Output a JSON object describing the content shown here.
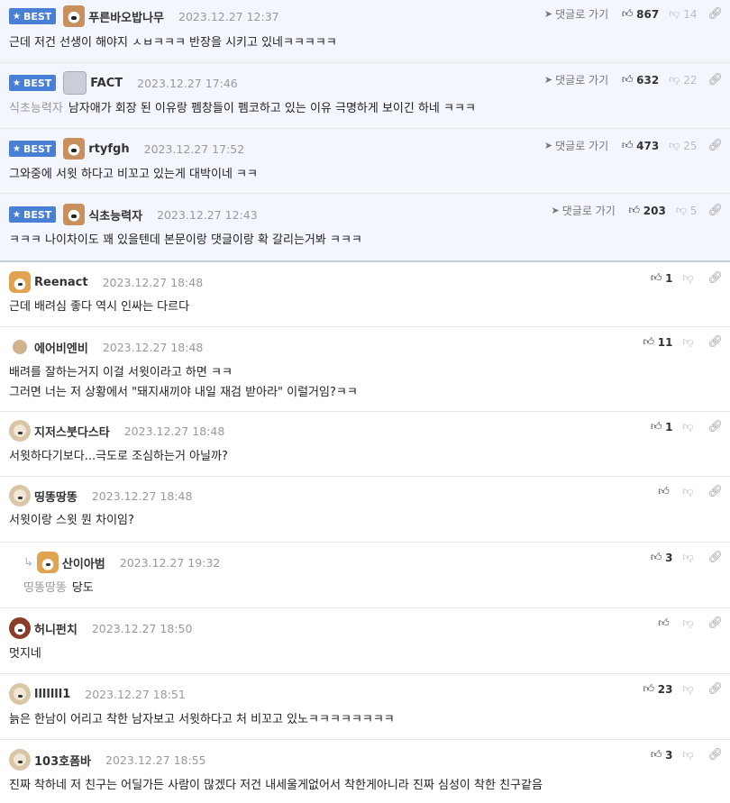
{
  "best_badge": "BEST",
  "go_label": "댓글로 가기",
  "best_comments": [
    {
      "nick": "푸른바오밥나무",
      "time": "2023.12.27 12:37",
      "ref": "",
      "text": "근데 저건 선생이 해야지 ㅅㅂㅋㅋㅋ 반장을 시키고 있네ㅋㅋㅋㅋㅋ",
      "up": "867",
      "down": "14",
      "avatar": "dog-icon"
    },
    {
      "nick": "FACT",
      "time": "2023.12.27 17:46",
      "ref": "식초능력자",
      "text": "남자애가 회장 된 이유랑 펨창들이 펨코하고 있는 이유 극명하게 보이긴 하네 ㅋㅋㅋ",
      "up": "632",
      "down": "22",
      "avatar": "gray-avatar-icon"
    },
    {
      "nick": "rtyfgh",
      "time": "2023.12.27 17:52",
      "ref": "",
      "text": "그와중에 서윗 하다고 비꼬고 있는게 대박이네 ㅋㅋ",
      "up": "473",
      "down": "25",
      "avatar": "dog-icon"
    },
    {
      "nick": "식초능력자",
      "time": "2023.12.27 12:43",
      "ref": "",
      "text": "ㅋㅋㅋ 나이차이도 꽤 있을텐데 본문이랑 댓글이랑 확 갈리는거봐 ㅋㅋㅋ",
      "up": "203",
      "down": "5",
      "avatar": "dog-icon"
    }
  ],
  "comments": [
    {
      "nick": "Reenact",
      "time": "2023.12.27 18:48",
      "ref": "",
      "lines": [
        "근데 배려심 좋다 역시 인싸는 다르다"
      ],
      "up": "1",
      "avatar": "corgi-icon",
      "reply": false
    },
    {
      "nick": "에어비엔비",
      "time": "2023.12.27 18:48",
      "ref": "",
      "lines": [
        "배려를 잘하는거지 이걸 서윗이라고 하면 ㅋㅋ",
        "그러면 너는 저 상황에서 \"돼지새끼야 내일 재검 받아라\" 이럴거임?ㅋㅋ"
      ],
      "up": "11",
      "avatar": "brown-dot-icon",
      "reply": false
    },
    {
      "nick": "지저스붓다스타",
      "time": "2023.12.27 18:48",
      "ref": "",
      "lines": [
        "서윗하다기보다...극도로 조심하는거 아닐까?"
      ],
      "up": "1",
      "avatar": "beige-icon",
      "reply": false
    },
    {
      "nick": "띵똥땅똥",
      "time": "2023.12.27 18:48",
      "ref": "",
      "lines": [
        "서윗이랑 스윗 뭔 차이임?"
      ],
      "up": "",
      "avatar": "beige-icon",
      "reply": false
    },
    {
      "nick": "산이아범",
      "time": "2023.12.27 19:32",
      "ref": "띵똥땅똥",
      "lines": [
        "당도"
      ],
      "up": "3",
      "avatar": "corgi-icon",
      "reply": true
    },
    {
      "nick": "허니펀치",
      "time": "2023.12.27 18:50",
      "ref": "",
      "lines": [
        "멋지네"
      ],
      "up": "",
      "avatar": "pink-dog-icon",
      "reply": false
    },
    {
      "nick": "lllllll1",
      "time": "2023.12.27 18:51",
      "ref": "",
      "lines": [
        "늙은 한남이 어리고 착한 남자보고 서윗하다고 처 비꼬고 있노ㅋㅋㅋㅋㅋㅋㅋㅋ"
      ],
      "up": "23",
      "avatar": "beige-icon",
      "reply": false
    },
    {
      "nick": "103호폼바",
      "time": "2023.12.27 18:55",
      "ref": "",
      "lines": [
        "진짜 착하네 저 친구는 어딜가든 사람이 많겠다 저건 내세울게없어서 착한게아니라 진짜 심성이 착한 친구같음"
      ],
      "up": "3",
      "avatar": "beige-icon",
      "reply": false
    }
  ]
}
